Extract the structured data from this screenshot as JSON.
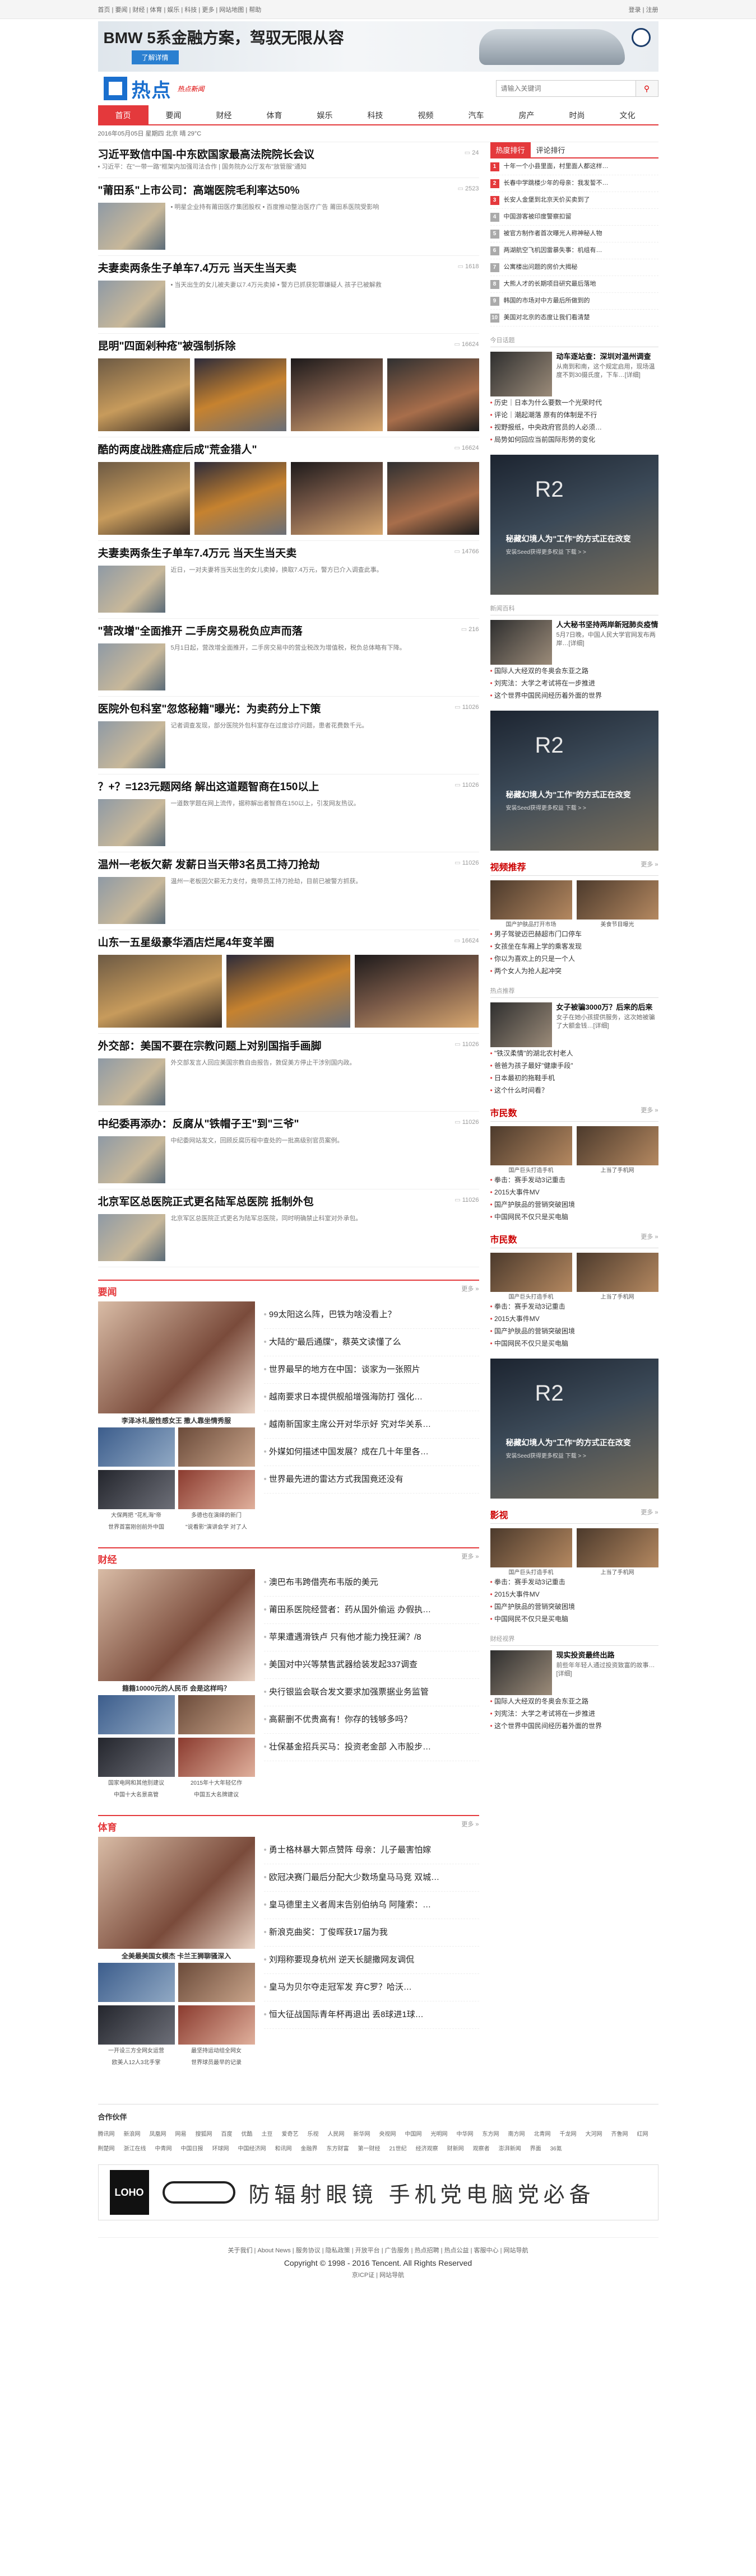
{
  "topbar": {
    "links": "首页 | 要闻 | 财经 | 体育 | 娱乐 | 科技 | 更多 | 网站地图 | 帮助",
    "login": "登录 | 注册"
  },
  "banner": {
    "title": "BMW 5系金融方案，驾驭无限从容",
    "button": "了解详情"
  },
  "site": {
    "logo": "热点",
    "sub": "热点新闻"
  },
  "search": {
    "placeholder": "请输入关键词",
    "icon": "search-icon"
  },
  "nav": [
    "首页",
    "要闻",
    "财经",
    "体育",
    "娱乐",
    "科技",
    "视频",
    "汽车",
    "房产",
    "时尚",
    "文化"
  ],
  "datebar": "2016年05月05日   星期四   北京 晴 29°C",
  "left": {
    "top": {
      "title": "习近平致信中国-中东欧国家最高法院院长会议",
      "count": "24",
      "bullets": "• 习近平：在\"一带一路\"框架内加强司法合作 | 国务院办公厅发布\"放管服\"通知"
    },
    "items": [
      {
        "title": "\"莆田系\"上市公司：高端医院毛利率达50%",
        "count": "2523",
        "sub": "• 明星企业持有莆田医疗集团股权\n• 百度推动整治医疗广告 莆田系医院受影响"
      },
      {
        "title": "夫妻卖两条生子单车7.4万元 当天生当天卖",
        "count": "1618",
        "sub": "• 当天出生的女儿被夫妻以7.4万元卖掉\n• 警方已抓获犯罪嫌疑人 孩子已被解救"
      },
      {
        "title": "昆明\"四面剁种疮\"被强制拆除",
        "count": "16624",
        "type": "pics"
      },
      {
        "title": "酷的两度战胜癌症后成\"荒金猎人\"",
        "count": "16624",
        "type": "pics"
      },
      {
        "title": "夫妻卖两条生子单车7.4万元 当天生当天卖",
        "count": "14766",
        "sub": "近日，一对夫妻将当天出生的女儿卖掉，换取7.4万元，警方已介入调查此事。"
      },
      {
        "title": "\"营改增\"全面推开 二手房交易税负应声而落",
        "count": "216",
        "sub": "5月1日起，营改增全面推开，二手房交易中的营业税改为增值税，税负总体略有下降。"
      },
      {
        "title": "医院外包科室\"忽悠秘籍\"曝光：为卖药分上下策",
        "count": "11026",
        "sub": "记者调查发现，部分医院外包科室存在过度诊疗问题，患者花费数千元。"
      },
      {
        "title": "？+？=123元题网络 解出这道题智商在150以上",
        "count": "11026",
        "sub": "一道数学题在网上流传，据称解出者智商在150以上，引发网友热议。"
      },
      {
        "title": "温州一老板欠薪 发薪日当天带3名员工持刀抢劫",
        "count": "11026",
        "sub": "温州一老板因欠薪无力支付，竟带员工持刀抢劫，目前已被警方抓获。"
      },
      {
        "title": "山东一五星级豪华酒店烂尾4年变羊圈",
        "count": "16624",
        "type": "pics3"
      },
      {
        "title": "外交部：美国不要在宗教问题上对别国指手画脚",
        "count": "11026",
        "sub": "外交部发言人回应美国宗教自由报告，敦促美方停止干涉别国内政。"
      },
      {
        "title": "中纪委再添办：反腐从\"铁帽子王\"到\"三爷\"",
        "count": "11026",
        "sub": "中纪委网站发文，回顾反腐历程中查处的一批高级别官员案例。"
      },
      {
        "title": "北京军区总医院正式更名陆军总医院 抵制外包",
        "count": "11026",
        "sub": "北京军区总医院正式更名为陆军总医院，同时明确禁止科室对外承包。"
      }
    ],
    "sections": [
      {
        "name": "要闻",
        "more": "更多 »",
        "cap": "李泽冰礼服性感女王 撒人靠坐情秀服",
        "caps": [
          "大保两把 \"花札海\"帝",
          "多德也在演绎的新门",
          "世界首富刚创前外中国",
          "\"说看影\"演讲会学 对了人"
        ],
        "list": [
          "99太阳这么阵，巴铁为啥没看上？",
          "大陆的\"最后通牒\"，蔡英文读懂了么",
          "世界最早的地方在中国：谈家为一张照片",
          "越南要求日本提供舰船增强海防打 强化…",
          "越南新国家主席公开对华示好 究对华关系…",
          "外媒如何描述中国发展？成在几十年里各…",
          "世界最先进的雷达方式我国竟还没有"
        ]
      },
      {
        "name": "财经",
        "more": "更多 »",
        "cap": "籍籍10000元的人民币 会是这样吗？",
        "caps": [
          "国家电网和其他别建议",
          "2015年十大年轻亿作",
          "中国十大名景高管",
          "中国五大名牌建议"
        ],
        "list": [
          "澳巴布韦跨借壳布韦版的美元",
          "莆田系医院经营者：药从国外偷运 办假执…",
          "苹果遭遇滑铁卢 只有他才能力挽狂澜？/8",
          "美国对中兴等禁售武器给装发起337调查",
          "央行银监会联合发文要求加强票据业务监管",
          "高薪删不优贵高有！你存的钱够多吗？",
          "壮保基金招兵买马：投资老金部 入市股步…"
        ]
      },
      {
        "name": "体育",
        "more": "更多 »",
        "cap": "全美最美国女模杰 卡兰王狮聊骚深入",
        "caps": [
          "一开设三方全网女运营",
          "最坚持运动组全网女",
          "欧美人12人3北手掌",
          "世界球员最早的记录"
        ],
        "list": [
          "勇士格林暴大郭点赞阵 母亲：儿子最害怕嫁",
          "欧冠决赛门最后分配大少数场皇马马竞 双城…",
          "皇马德里主义者周末告别伯纳乌 阿隆索：…",
          "新浪克曲奖：丁俊晖获17届为我",
          "刘翔称要现身杭州 逆天长腿撒网友调侃",
          "皇马为贝尔夺走冠军发 弃C罗？哈沃…",
          "恒大征战国际青年杯再退出 丢8球进1球…"
        ]
      }
    ]
  },
  "right": {
    "tabs": [
      "热度排行",
      "评论排行"
    ],
    "rank": [
      "十年一个小县里面，村里面人都这样…",
      "长春中学跳楼少年的母亲：我发誓不…",
      "长安人金堡到北京天价买卖到了",
      "中国游客被印度警察扣留",
      "被官方制作者首次曝光人称神秘人物",
      "两湖航空飞机因雷暴失事：机组有…",
      "公寓楼出问题的房价大揭秘",
      "大熊人才的长期项目研究最后落地",
      "韩国的市场对中方最后所做到的",
      "美国对北京的态度让我们看清楚"
    ],
    "box1": {
      "title": "今日话题",
      "feature": {
        "title": "动车逐站查：深圳对温州调查",
        "desc": "从南到和南，这个规定启用，现场温度不到30摄氏度，下车…[详细]"
      },
      "list": [
        "历史｜日本为什么要数一个光荣时代",
        "评论｜潮起潮落 原有的体制是不行",
        "视野报纸，中央政府官员的人必须…",
        "局势如何回应当前国际形势的变化"
      ]
    },
    "ad1": {
      "title": "R2",
      "line1": "秘藏幻境人为\"工作\"的方式正在改变",
      "line2": "安装Seed获得更多权益 下载 > >"
    },
    "box2": {
      "title": "新闻百科",
      "feature": {
        "title": "人大秘书坚持两岸新冠肺炎疫情",
        "desc": "5月7日晚，中国人民大学官网发布两岸…[详细]"
      },
      "list": [
        "国际人大经双的冬奥会东亚之路",
        "刘宪法：大学之考试将在一步推进",
        "这个世界中国民间经历着外面的世界"
      ]
    },
    "ad2": {
      "title": "R2",
      "line1": "秘藏幻境人为\"工作\"的方式正在改变",
      "line2": "安装Seed获得更多权益 下载 > >"
    },
    "box3": {
      "title": "视频推荐",
      "more": "更多 »",
      "caps": [
        "国产护肤品打开市场",
        "美食节目曝光"
      ],
      "list": [
        "男子驾驶迈巴赫超市门口停车",
        "女孩坐在车厢上学的乘客发现",
        "你以为喜欢上的只是一个人",
        "两个女人为抢人起冲突"
      ]
    },
    "box4": {
      "title": "热点推荐",
      "feature": {
        "title": "女子被骗3000万？后来的后来",
        "desc": "女子在她小孩提供服务，这次她被骗了大额金钱…[详细]"
      },
      "list": [
        "\"铁汉柔情\"的湖北农村老人",
        "爸爸为孩子最好\"健康手段\"",
        "日本最初的拖鞋手机",
        "这个什么时间看？"
      ]
    },
    "box5": {
      "title": "市民数",
      "more": "更多 »",
      "caps": [
        "国产巨头打造手机",
        "上当了手机网"
      ],
      "list": [
        "拳击：赛手发动3记重击",
        "2015大事件MV",
        "国产护肤品的营销突破困境",
        "中国网民不仅只是买电脑"
      ]
    },
    "box6": {
      "title": "市民数",
      "more": "更多 »",
      "caps": [
        "国产巨头打造手机",
        "上当了手机网"
      ],
      "list": [
        "拳击：赛手发动3记重击",
        "2015大事件MV",
        "国产护肤品的营销突破困境",
        "中国网民不仅只是买电脑"
      ]
    },
    "ad3": {
      "title": "R2",
      "line1": "秘藏幻境人为\"工作\"的方式正在改变",
      "line2": "安装Seed获得更多权益 下载 > >"
    },
    "box7": {
      "title": "影视",
      "more": "更多 »",
      "caps": [
        "国产巨头打造手机",
        "上当了手机网"
      ],
      "list": [
        "拳击：赛手发动3记重击",
        "2015大事件MV",
        "国产护肤品的营销突破困境",
        "中国网民不仅只是买电脑"
      ]
    },
    "box8": {
      "title": "财经视界",
      "feature": {
        "title": "现实投资最终出路",
        "desc": "前些年年轻人通过投资致富的故事…[详细]"
      },
      "list": [
        "国际人大经双的冬奥会东亚之路",
        "刘宪法：大学之考试将在一步推进",
        "这个世界中国民间经历着外面的世界"
      ]
    }
  },
  "partner": {
    "title": "合作伙伴",
    "links": [
      "腾讯网",
      "新浪网",
      "凤凰网",
      "网易",
      "搜狐网",
      "百度",
      "优酷",
      "土豆",
      "爱奇艺",
      "乐视",
      "人民网",
      "新华网",
      "央视网",
      "中国网",
      "光明网",
      "中华网",
      "东方网",
      "南方网",
      "北青网",
      "千龙网",
      "大河网",
      "齐鲁网",
      "红网",
      "荆楚网",
      "浙江在线",
      "中青网",
      "中国日报",
      "环球网",
      "中国经济网",
      "和讯网",
      "金融界",
      "东方财富",
      "第一财经",
      "21世纪",
      "经济观察",
      "财新网",
      "观察者",
      "澎湃新闻",
      "界面",
      "36氪"
    ]
  },
  "bottomad": {
    "brand": "LOHO",
    "text": "防辐射眼镜 手机党电脑党必备"
  },
  "footer": {
    "links": "关于我们 | About News | 服务协议 | 隐私政策 | 开放平台 | 广告服务 | 热点招聘 | 热点公益 | 客服中心 | 网站导航",
    "copyright": "Copyright © 1998 - 2016 Tencent. All Rights Reserved",
    "icp": "京ICP证 | 网站导航"
  }
}
